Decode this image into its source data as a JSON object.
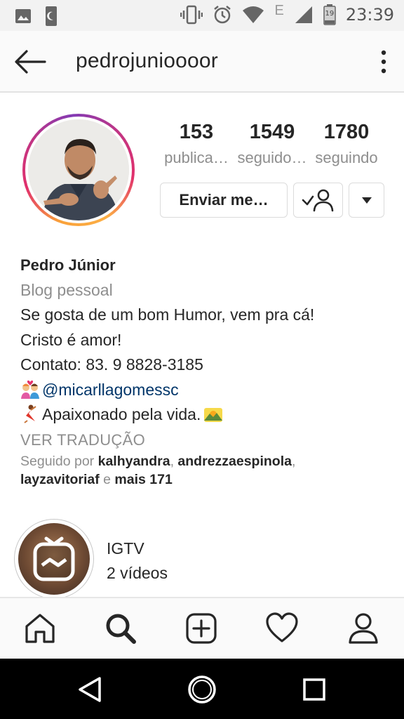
{
  "status_bar": {
    "time": "23:39",
    "battery_level": "19",
    "network_label": "E",
    "left_icons": [
      "gallery-icon",
      "sim-moon-icon"
    ],
    "right_icons": [
      "vibrate-icon",
      "alarm-icon",
      "wifi-icon",
      "network-e-icon",
      "signal-icon",
      "battery-icon"
    ]
  },
  "app_bar": {
    "username": "pedrojunioooor",
    "back_icon": "back-arrow-icon",
    "menu_icon": "more-vertical-icon"
  },
  "profile": {
    "stats": [
      {
        "value": "153",
        "label": "publica…"
      },
      {
        "value": "1549",
        "label": "seguido…"
      },
      {
        "value": "1780",
        "label": "seguindo"
      }
    ],
    "message_button": "Enviar me…",
    "follow_button_icon": "following-check-person-icon",
    "dropdown_icon": "caret-down-icon",
    "ring_colors": [
      "#f9a13a",
      "#e1306c",
      "#c13584",
      "#833ab4"
    ]
  },
  "bio": {
    "name": "Pedro Júnior",
    "category": "Blog pessoal",
    "lines": [
      "Se gosta de um bom Humor, vem pra cá!",
      "Cristo é amor!",
      "Contato: 83. 9 8828-3185"
    ],
    "mention": "@micarllagomessc",
    "passion_line": "Apaixonado pela vida.",
    "translate": "VER TRADUÇÃO",
    "followed_by_prefix": "Seguido por ",
    "followed_user_1": "kalhyandra",
    "followed_sep_1": ", ",
    "followed_user_2": "andrezzaespinola",
    "followed_sep_2": ",",
    "followed_user_3": "layzavitoriaf",
    "followed_and": " e ",
    "followed_more": "mais 171"
  },
  "igtv": {
    "title": "IGTV",
    "subtitle": "2 vídeos",
    "icon": "igtv-icon"
  },
  "tab_bar": {
    "tabs": [
      "home-icon",
      "search-icon",
      "add-post-icon",
      "activity-heart-icon",
      "profile-icon"
    ],
    "active": "search-icon"
  },
  "nav_bar": {
    "buttons": [
      "back-triangle-icon",
      "home-circle-icon",
      "recents-square-icon"
    ]
  },
  "colors": {
    "text": "#262626",
    "muted": "#8e8e8e",
    "mention": "#003569",
    "border": "#dbdbdb"
  }
}
